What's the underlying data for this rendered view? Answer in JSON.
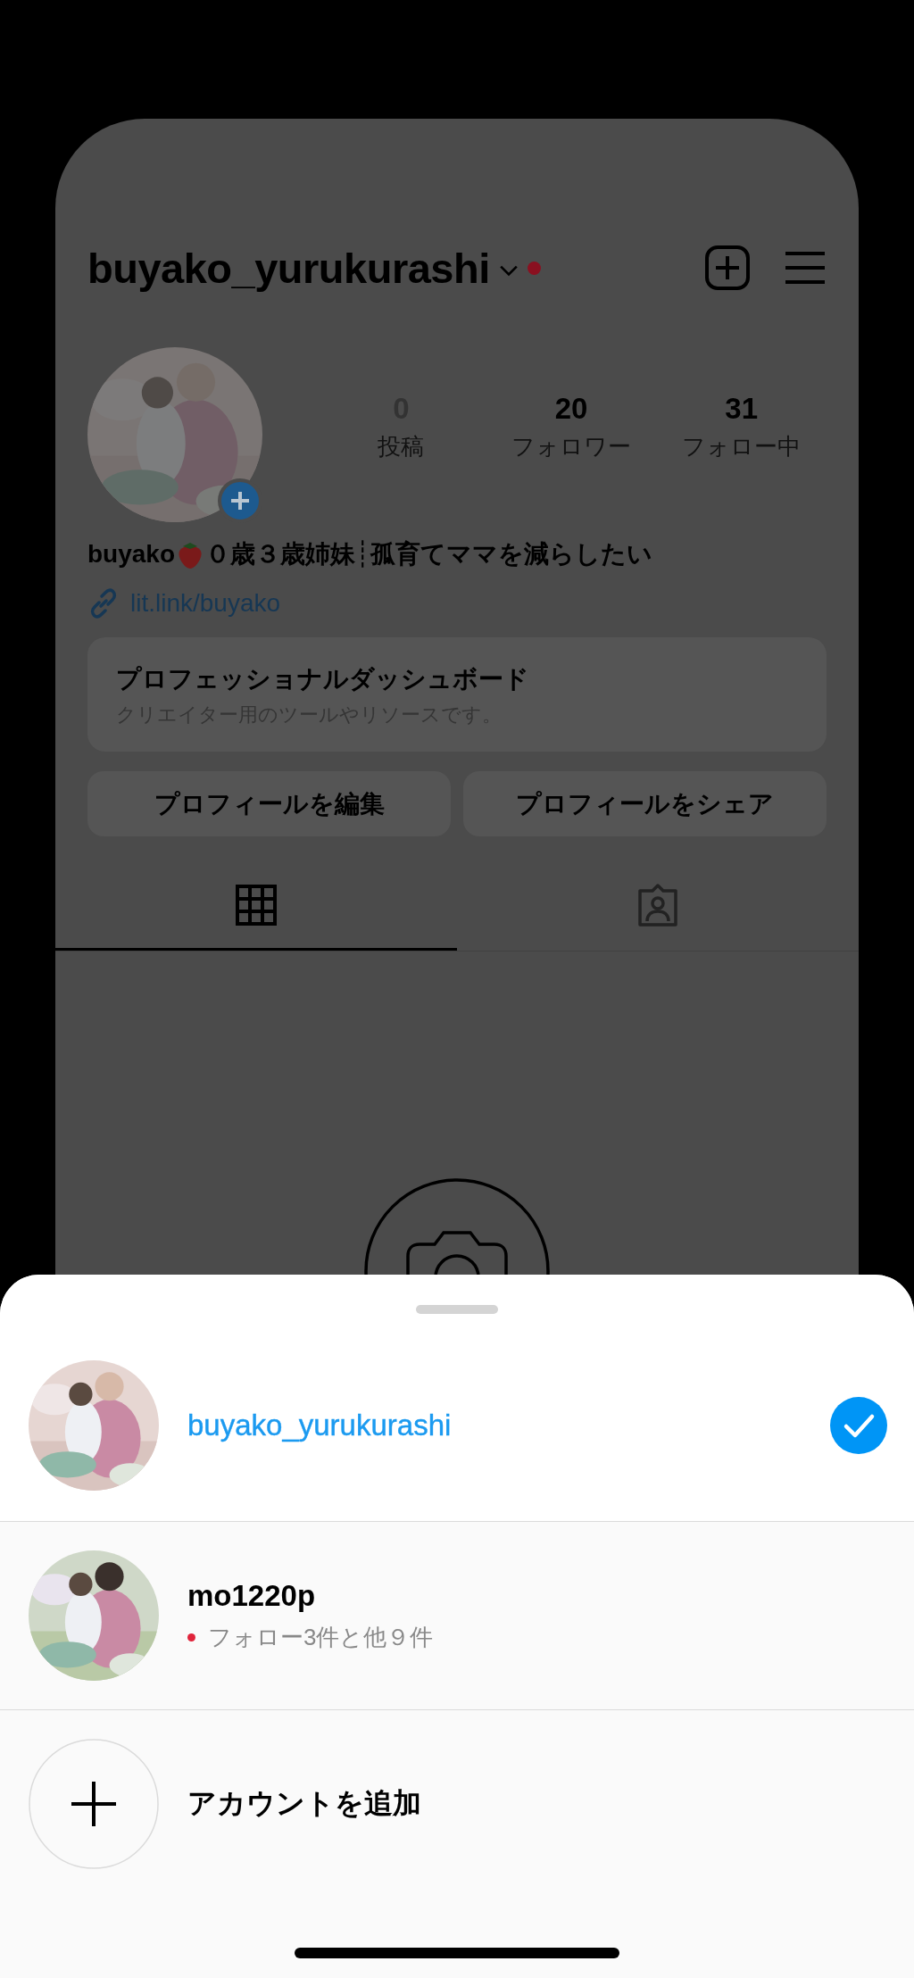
{
  "profile": {
    "username": "buyako_yurukurashi",
    "has_notification": true,
    "stats": [
      {
        "value": "0",
        "label": "投稿",
        "disabled": true
      },
      {
        "value": "20",
        "label": "フォロワー",
        "disabled": false
      },
      {
        "value": "31",
        "label": "フォロー中",
        "disabled": false
      }
    ],
    "bio_name": "buyako",
    "bio_text": "０歳３歳姉妹┊孤育てママを減らしたい",
    "link": "lit.link/buyako",
    "dashboard": {
      "title": "プロフェッショナルダッシュボード",
      "subtitle": "クリエイター用のツールやリソースです。"
    },
    "buttons": [
      "プロフィールを編集",
      "プロフィールをシェア"
    ],
    "tabs": [
      {
        "kind": "grid",
        "selected": true
      },
      {
        "kind": "tagged",
        "selected": false
      }
    ]
  },
  "account_sheet": {
    "accounts": [
      {
        "username": "buyako_yurukurashi",
        "selected": true
      },
      {
        "username": "mo1220p",
        "selected": false,
        "notification": "フォロー3件と他９件"
      }
    ],
    "add_account": "アカウントを追加"
  }
}
